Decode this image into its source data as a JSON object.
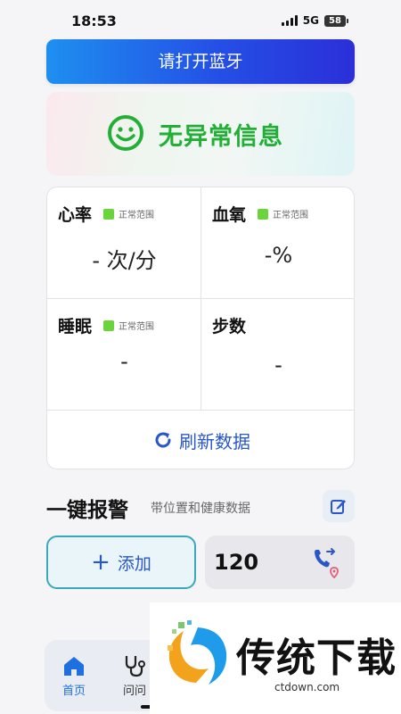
{
  "status_bar": {
    "time": "18:53",
    "network": "5G",
    "battery": "58"
  },
  "bluetooth_button": "请打开蓝牙",
  "status_card": {
    "text": "无异常信息",
    "color": "#21b035"
  },
  "metrics": {
    "heart_rate": {
      "title": "心率",
      "badge": "正常范围",
      "value": "- 次/分"
    },
    "blood_oxygen": {
      "title": "血氧",
      "badge": "正常范围",
      "value": "-%"
    },
    "sleep": {
      "title": "睡眠",
      "badge": "正常范围",
      "value": "-"
    },
    "steps": {
      "title": "步数",
      "value": "-"
    }
  },
  "refresh_label": "刷新数据",
  "sos": {
    "title": "一键报警",
    "subtitle": "带位置和健康数据",
    "add_label": "添加",
    "contact_number": "120"
  },
  "nav": {
    "home": "首页",
    "consult": "问问"
  },
  "watermark": {
    "text": "传统下载",
    "url": "ctdown.com"
  },
  "colors": {
    "accent": "#2a57c8",
    "normal_badge": "#6bd43a"
  },
  "icons": [
    "smile-icon",
    "refresh-icon",
    "edit-icon",
    "plus-icon",
    "phone-icon",
    "location-pin-icon",
    "home-icon",
    "stethoscope-icon"
  ]
}
